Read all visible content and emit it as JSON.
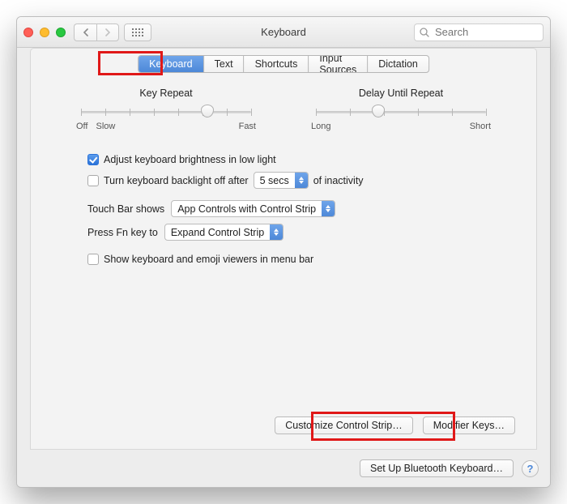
{
  "window": {
    "title": "Keyboard"
  },
  "search": {
    "placeholder": "Search"
  },
  "tabs": [
    "Keyboard",
    "Text",
    "Shortcuts",
    "Input Sources",
    "Dictation"
  ],
  "active_tab_index": 0,
  "sliders": {
    "key_repeat": {
      "title": "Key Repeat",
      "left_labels": [
        "Off",
        "Slow"
      ],
      "right_label": "Fast",
      "position_pct": 72,
      "ticks": 8
    },
    "delay_until_repeat": {
      "title": "Delay Until Repeat",
      "left_label": "Long",
      "right_label": "Short",
      "position_pct": 38,
      "ticks": 6
    }
  },
  "checkboxes": {
    "adjust_brightness": {
      "label": "Adjust keyboard brightness in low light",
      "checked": true
    },
    "turn_off_backlight": {
      "prefix": "Turn keyboard backlight off after",
      "suffix": "of inactivity",
      "checked": false
    },
    "show_viewers": {
      "label": "Show keyboard and emoji viewers in menu bar",
      "checked": false
    }
  },
  "backlight_timeout": {
    "value": "5 secs"
  },
  "touch_bar": {
    "label": "Touch Bar shows",
    "value": "App Controls with Control Strip"
  },
  "fn_key": {
    "label": "Press Fn key to",
    "value": "Expand Control Strip"
  },
  "buttons": {
    "customize": "Customize Control Strip…",
    "modifier": "Modifier Keys…",
    "bluetooth": "Set Up Bluetooth Keyboard…"
  },
  "help": "?"
}
